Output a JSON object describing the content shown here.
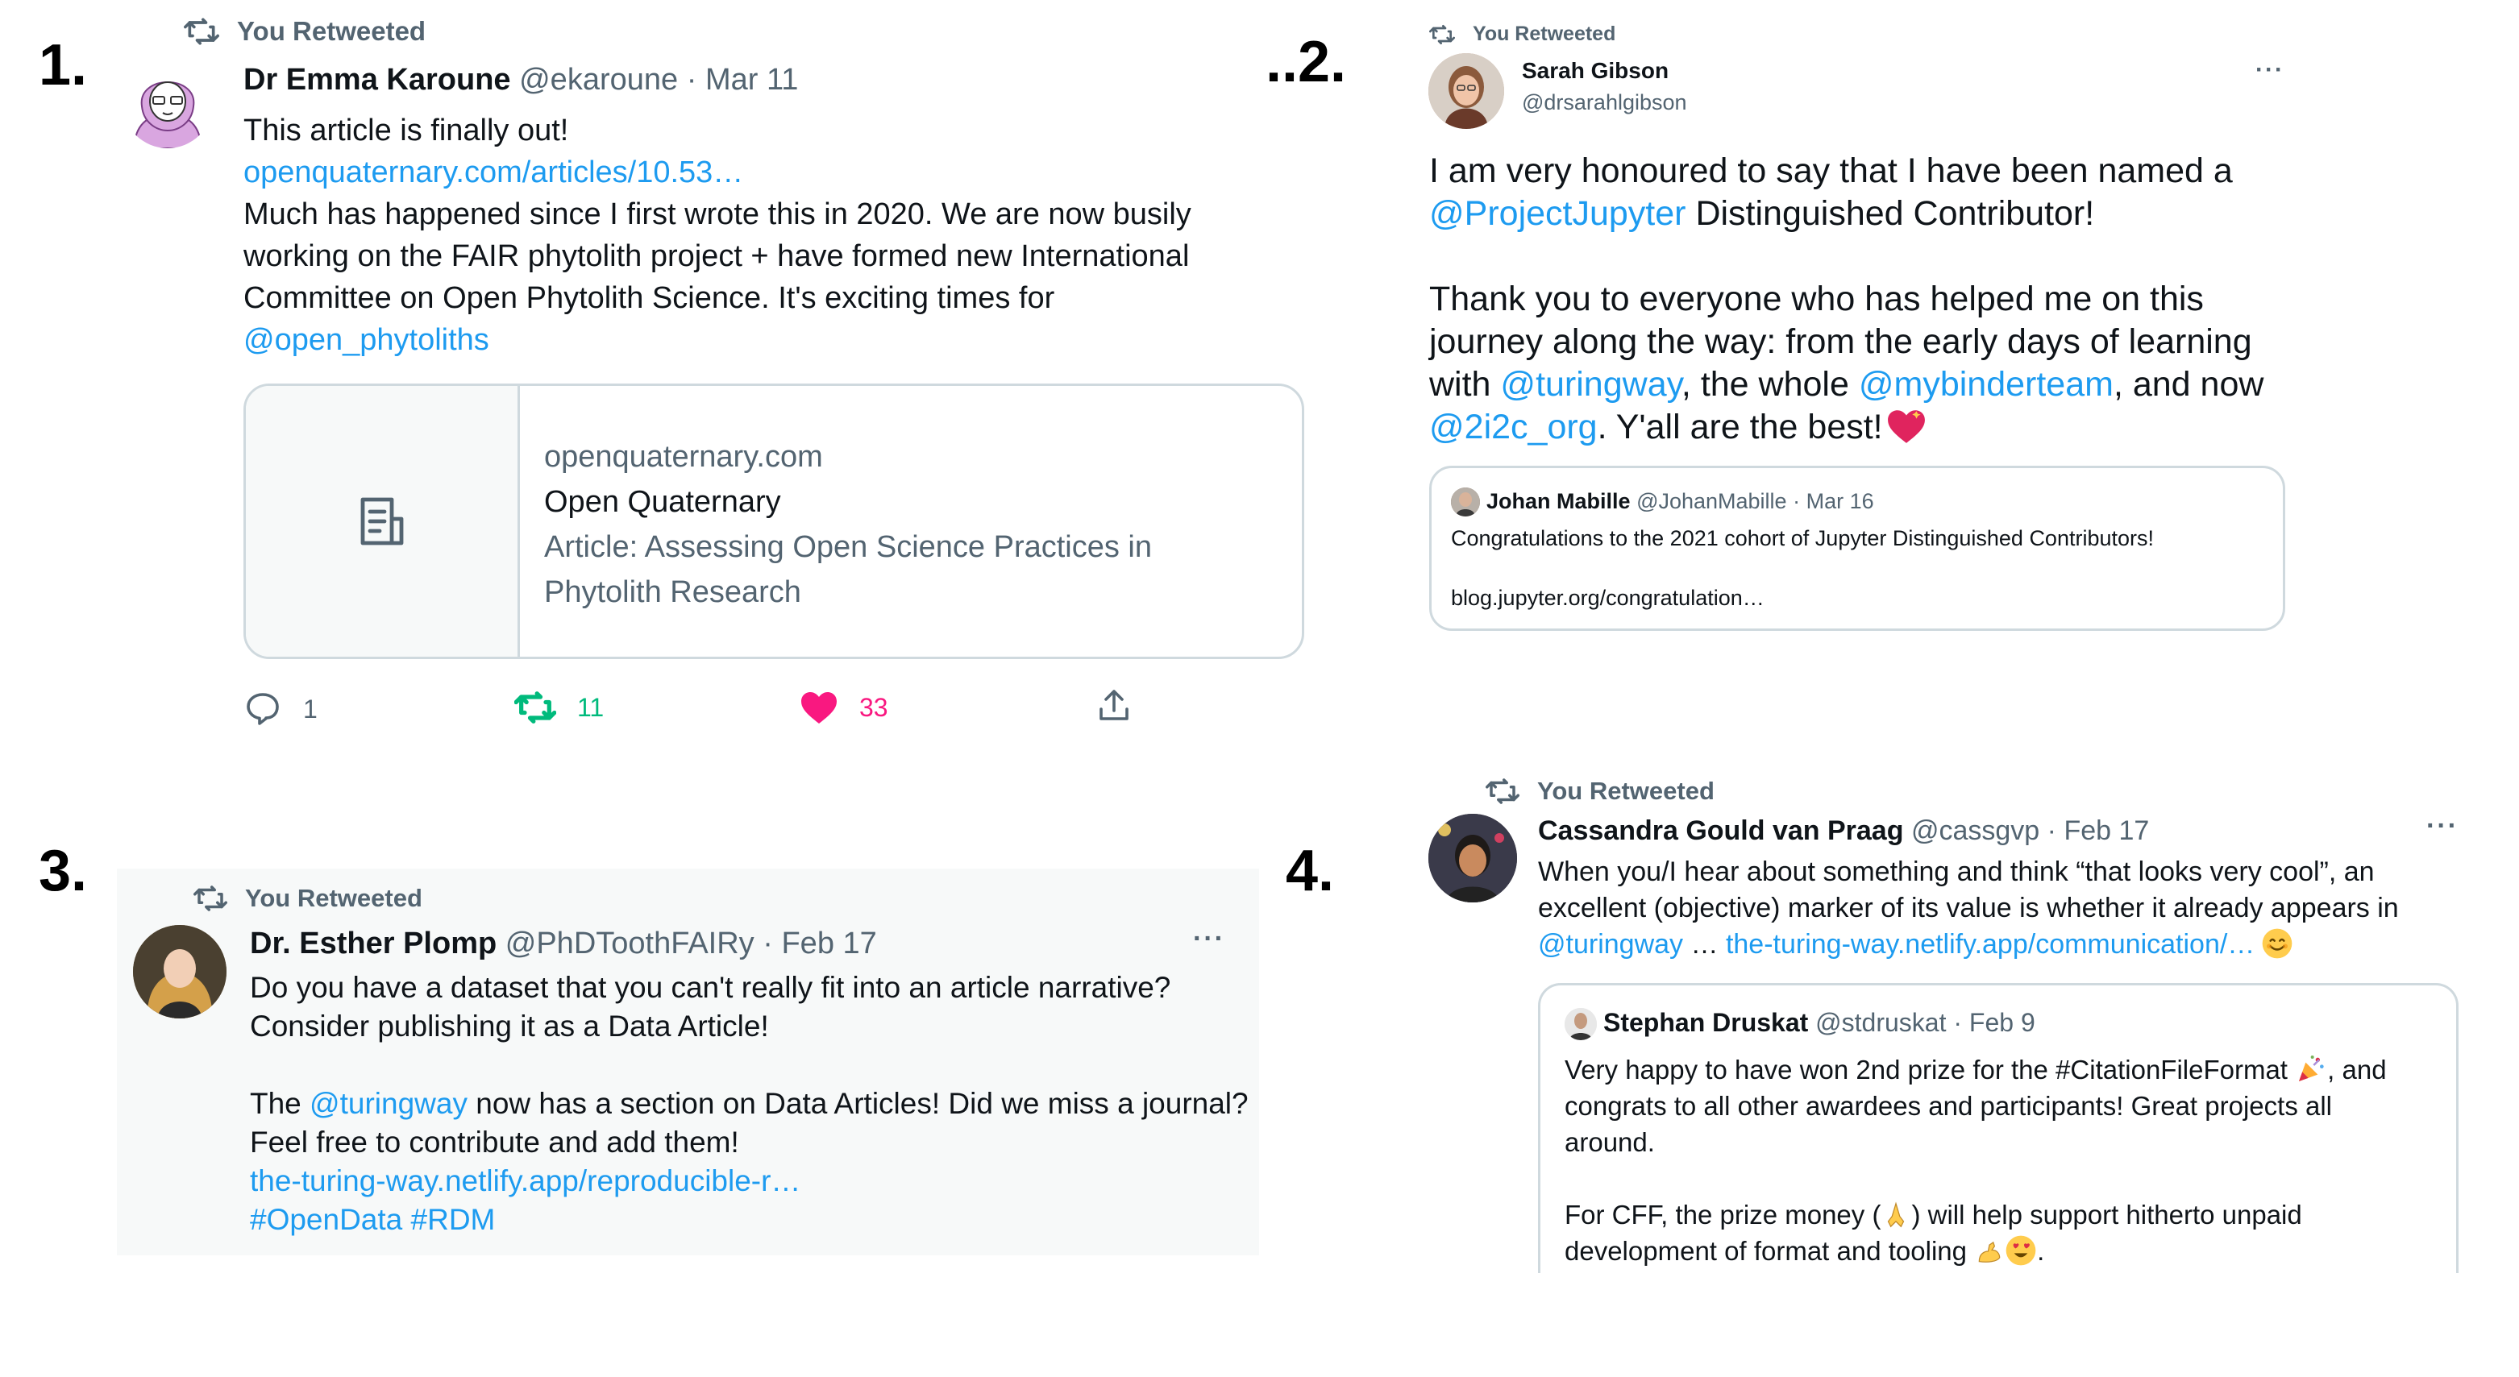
{
  "labels": {
    "n1": "1.",
    "n2": "..2.",
    "n3": "3.",
    "n4": "4."
  },
  "colors": {
    "link": "#1d9bf0",
    "retweet_green": "#00ba7c",
    "like_pink": "#f91880",
    "muted": "#536471"
  },
  "icons": [
    "retweet-icon",
    "reply-icon",
    "like-icon",
    "share-icon",
    "document-icon",
    "more-icon"
  ],
  "t1": {
    "retweeted": "You Retweeted",
    "name": "Dr Emma Karoune",
    "handle": "@ekaroune",
    "sep": "·",
    "date": "Mar 11",
    "line1": "This article is finally out!",
    "link1": "openquaternary.com/articles/10.53…",
    "line2": "Much has happened since I first wrote this in 2020. We are now busily",
    "line3": "working on the FAIR phytolith project + have formed new International",
    "line4": "Committee on Open Phytolith Science. It's exciting times for",
    "mention": "@open_phytoliths",
    "card": {
      "domain": "openquaternary.com",
      "site": "Open Quaternary",
      "title1": "Article: Assessing Open Science Practices in",
      "title2": "Phytolith Research"
    },
    "replies": "1",
    "retweets": "11",
    "likes": "33"
  },
  "t2": {
    "retweeted": "You Retweeted",
    "name": "Sarah Gibson",
    "handle": "@drsarahlgibson",
    "more": "···",
    "p1a": "I am very honoured to say that I have been named a",
    "p1b_link": "@ProjectJupyter",
    "p1b_text": " Distinguished Contributor!",
    "p2a": "Thank you to everyone who has helped me on this",
    "p2b": "journey along the way: from the early days of learning",
    "p2c_pre": "with ",
    "p2c_link1": "@turingway",
    "p2c_mid": ", the whole ",
    "p2c_link2": "@mybinderteam",
    "p2c_post": ", and now",
    "p2d_link": "@2i2c_org",
    "p2d_post": ". Y'all are the best!",
    "quote": {
      "name": "Johan Mabille",
      "handle": "@JohanMabille",
      "sep": "·",
      "date": "Mar 16",
      "text": "Congratulations to the 2021 cohort of Jupyter Distinguished Contributors!",
      "link": "blog.jupyter.org/congratulation…"
    }
  },
  "t3": {
    "retweeted": "You Retweeted",
    "name": "Dr. Esther Plomp",
    "handle": "@PhDToothFAIRy",
    "sep": "·",
    "date": "Feb 17",
    "more": "···",
    "l1": "Do you have a dataset that you can't really fit into an article narrative?",
    "l2": "Consider publishing it as a Data Article!",
    "l3_pre": "The ",
    "l3_link": "@turingway",
    "l3_post": " now has a section on Data Articles! Did we miss a journal?",
    "l4": "Feel free to contribute and add them!",
    "l5_link": "the-turing-way.netlify.app/reproducible-r…",
    "l6_link": "#OpenData #RDM"
  },
  "t4": {
    "retweeted": "You Retweeted",
    "name": "Cassandra Gould van Praag",
    "handle": "@cassgvp",
    "sep": "·",
    "date": "Feb 17",
    "more": "···",
    "l1": "When you/I hear about something and think “that looks very cool”, an",
    "l2": "excellent (objective) marker of its value is whether it already appears in",
    "l3_link1": "@turingway",
    "l3_mid": " … ",
    "l3_link2": "the-turing-way.netlify.app/communication/…",
    "quote": {
      "name": "Stephan Druskat",
      "handle": "@stdruskat",
      "sep": "·",
      "date": "Feb 9",
      "l1": "Very happy to have won 2nd prize for the #CitationFileFormat",
      "l1_end": ", and",
      "l2": "congrats to all other awardees and participants! Great projects all",
      "l3": "around.",
      "l4_pre": "For CFF, the prize money (",
      "l4_post": ") will help support hitherto unpaid",
      "l5": "development of format and tooling"
    }
  }
}
